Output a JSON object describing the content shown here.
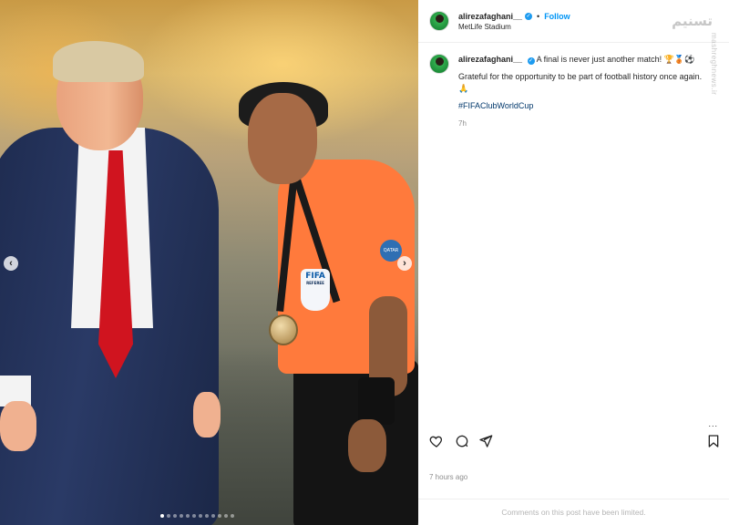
{
  "post": {
    "username": "alirezafaghani__",
    "follow_label": "Follow",
    "separator": "•",
    "location": "MetLife Stadium",
    "caption_line1": "A final is never just another match! 🏆🥉⚽",
    "caption_line2": "Grateful for the opportunity to be part of football history once again. 🙏",
    "hashtag": "#FIFAClubWorldCup",
    "relative_time": "7h",
    "time_ago": "7 hours ago",
    "comments_notice": "Comments on this post have been limited.",
    "more_label": "..."
  },
  "watermark": {
    "logo_text": "تسنیم",
    "side_text": "mashreghnews.ir"
  },
  "photo": {
    "badge_text": "FIFA",
    "badge_sub": "REFEREE",
    "patch_text": "QATAR",
    "carousel": {
      "prev_symbol": "‹",
      "next_symbol": "›",
      "slide_count": 12,
      "active_index": 0
    }
  },
  "icons": {
    "like": "heart-icon",
    "comment": "comment-icon",
    "share": "share-icon",
    "save": "bookmark-icon",
    "verified": "verified-badge-icon"
  },
  "colors": {
    "follow": "#0095f6",
    "verified": "#1d9bf0",
    "hashtag": "#00376b",
    "referee_shirt": "#ff7a3c",
    "tie": "#d0141f"
  }
}
